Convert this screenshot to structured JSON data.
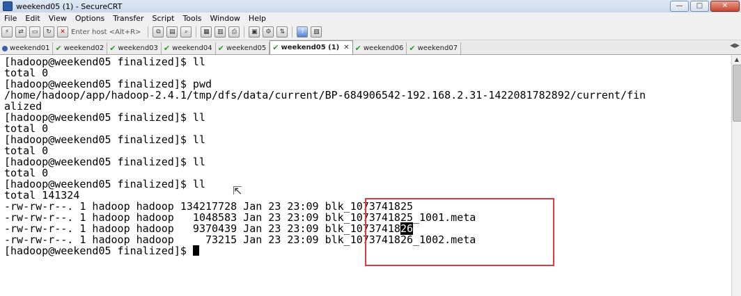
{
  "window": {
    "title": "weekend05 (1) - SecureCRT",
    "btn_min": "—",
    "btn_max": "□",
    "btn_close": "✕"
  },
  "menu": [
    "File",
    "Edit",
    "View",
    "Options",
    "Transfer",
    "Script",
    "Tools",
    "Window",
    "Help"
  ],
  "toolbar": {
    "host_placeholder": "Enter host <Alt+R>"
  },
  "tabs": [
    {
      "label": "weekend01",
      "status": "info"
    },
    {
      "label": "weekend02",
      "status": "ok"
    },
    {
      "label": "weekend03",
      "status": "ok"
    },
    {
      "label": "weekend04",
      "status": "ok"
    },
    {
      "label": "weekend05",
      "status": "ok"
    },
    {
      "label": "weekend05 (1)",
      "status": "ok",
      "active": true
    },
    {
      "label": "weekend06",
      "status": "ok"
    },
    {
      "label": "weekend07",
      "status": "ok"
    }
  ],
  "terminal": {
    "lines": [
      "[hadoop@weekend05 finalized]$ ll",
      "total 0",
      "[hadoop@weekend05 finalized]$ pwd",
      "/home/hadoop/app/hadoop-2.4.1/tmp/dfs/data/current/BP-684906542-192.168.2.31-1422081782892/current/fin",
      "alized",
      "[hadoop@weekend05 finalized]$ ll",
      "total 0",
      "[hadoop@weekend05 finalized]$ ll",
      "total 0",
      "[hadoop@weekend05 finalized]$ ll",
      "total 0",
      "[hadoop@weekend05 finalized]$ ll",
      "total 141324",
      "-rw-rw-r--. 1 hadoop hadoop 134217728 Jan 23 23:09 blk_1073741825",
      "-rw-rw-r--. 1 hadoop hadoop   1048583 Jan 23 23:09 blk_1073741825_1001.meta",
      "-rw-rw-r--. 1 hadoop hadoop   9370439 Jan 23 23:09 blk_10737418",
      "-rw-rw-r--. 1 hadoop hadoop     73215 Jan 23 23:09 blk_1073741826_1002.meta",
      "[hadoop@weekend05 finalized]$ "
    ],
    "highlighted_text": "26"
  }
}
